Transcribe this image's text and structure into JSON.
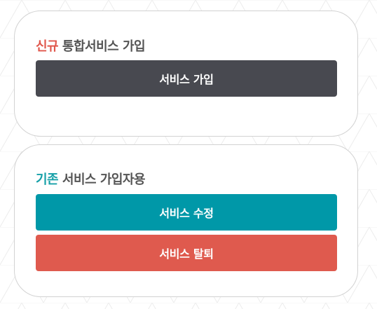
{
  "new_signup": {
    "title_accent": "신규",
    "title_rest": " 통합서비스 가입",
    "button_label": "서비스 가입"
  },
  "existing_user": {
    "title_accent": "기존",
    "title_rest": " 서비스 가입자용",
    "modify_button_label": "서비스 수정",
    "withdraw_button_label": "서비스 탈퇴"
  },
  "colors": {
    "accent_red": "#e0564b",
    "accent_teal": "#16a0a8",
    "button_dark": "#484950",
    "button_teal": "#0098a8",
    "button_red": "#df5a4e"
  }
}
